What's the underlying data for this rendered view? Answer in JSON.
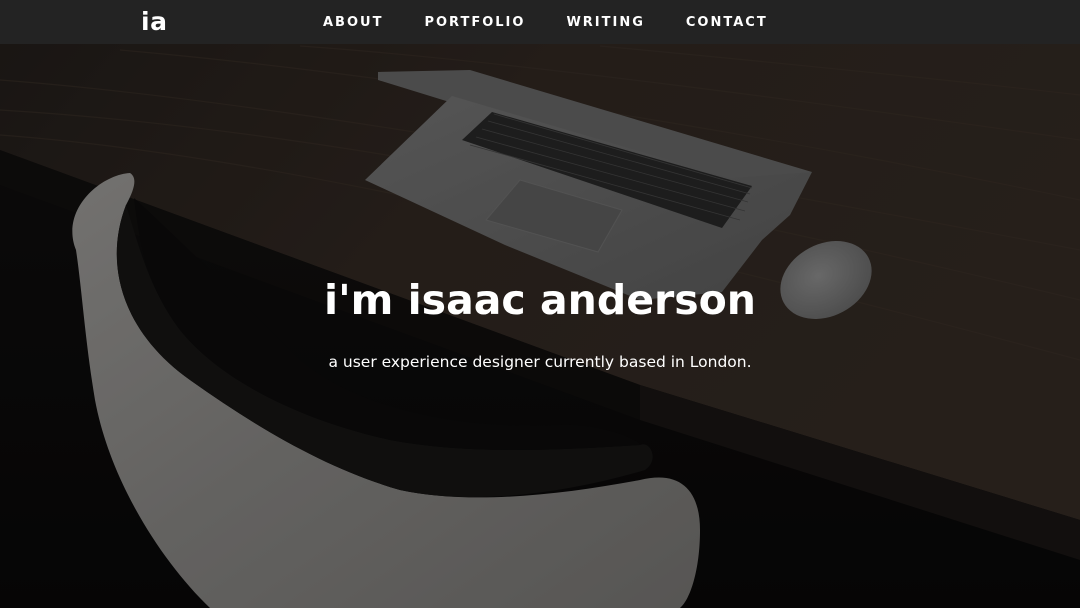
{
  "nav": {
    "logo": "ia",
    "links": [
      "ABOUT",
      "PORTFOLIO",
      "WRITING",
      "CONTACT"
    ]
  },
  "hero": {
    "title": "i'm isaac anderson",
    "subtitle": "a user experience designer currently based in London."
  },
  "colors": {
    "nav_background": "#232323",
    "nav_text": "#ffffff",
    "hero_text": "#ffffff",
    "page_background": "#0c0b0b"
  }
}
